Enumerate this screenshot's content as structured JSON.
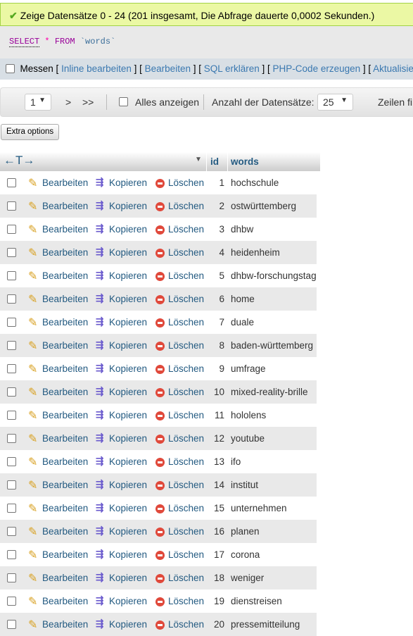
{
  "message": {
    "icon": "check-icon",
    "text": "Zeige Datensätze 0 - 24 (201 insgesamt, Die Abfrage dauerte 0,0002 Sekunden.)"
  },
  "query": {
    "select": "SELECT",
    "star": "*",
    "from": "FROM",
    "table": "`words`"
  },
  "query_links": {
    "messen": "Messen",
    "inline": "Inline bearbeiten",
    "edit": "Bearbeiten",
    "explain": "SQL erklären",
    "php": "PHP-Code erzeugen",
    "refresh": "Aktualisiere"
  },
  "nav": {
    "page": "1",
    "next": ">",
    "last": ">>",
    "show_all": "Alles anzeigen",
    "rows_label": "Anzahl der Datensätze:",
    "rows_value": "25",
    "filter_label": "Zeilen filtern"
  },
  "extra_options": "Extra options",
  "table": {
    "headers": {
      "id": "id",
      "words": "words"
    },
    "actions": {
      "edit": "Bearbeiten",
      "copy": "Kopieren",
      "delete": "Löschen"
    },
    "rows": [
      [
        "1",
        "hochschule"
      ],
      [
        "2",
        "ostwürttemberg"
      ],
      [
        "3",
        "dhbw"
      ],
      [
        "4",
        "heidenheim"
      ],
      [
        "5",
        "dhbw-forschungstag"
      ],
      [
        "6",
        "home"
      ],
      [
        "7",
        "duale"
      ],
      [
        "8",
        "baden-württemberg"
      ],
      [
        "9",
        "umfrage"
      ],
      [
        "10",
        "mixed-reality-brille"
      ],
      [
        "11",
        "hololens"
      ],
      [
        "12",
        "youtube"
      ],
      [
        "13",
        "ifo"
      ],
      [
        "14",
        "institut"
      ],
      [
        "15",
        "unternehmen"
      ],
      [
        "16",
        "planen"
      ],
      [
        "17",
        "corona"
      ],
      [
        "18",
        "weniger"
      ],
      [
        "19",
        "dienstreisen"
      ],
      [
        "20",
        "pressemitteilung"
      ]
    ]
  },
  "colors": {
    "success_bg": "#ebf8a4",
    "link": "#235a81",
    "row_alt": "#e9e9e9"
  }
}
